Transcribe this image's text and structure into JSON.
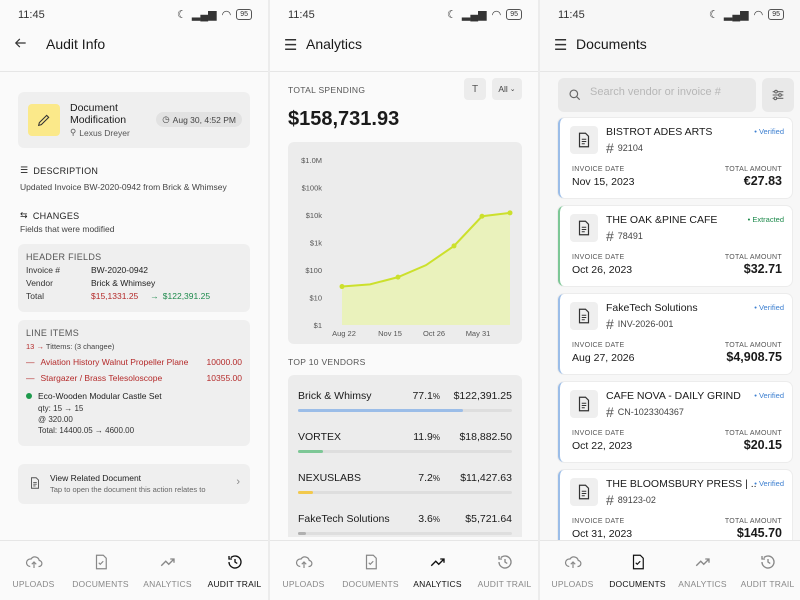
{
  "status": {
    "time": "11:45",
    "battery": "95"
  },
  "nav": {
    "uploads": "UPLOADS",
    "documents": "DOCUMENTS",
    "analytics": "ANALYTICS",
    "audit_trail": "AUDIT TRAIL"
  },
  "audit": {
    "title": "Audit Info",
    "doc_title": "Document Modification",
    "user": "Lexus Dreyer",
    "date": "Aug 30, 4:52 PM",
    "description_head": "DESCRIPTION",
    "description_text": "Updated Invoice BW-2020-0942 from Brick & Whimsey",
    "changes_head": "CHANGES",
    "changes_text": "Fields that were modified",
    "header_fields": {
      "label": "HEADER FIELDS",
      "rows": [
        {
          "k": "Invoice #",
          "v": "BW-2020-0942"
        },
        {
          "k": "Vendor",
          "v": "Brick & Whimsey"
        }
      ],
      "total_label": "Total",
      "total_old": "$15,1331.25",
      "total_new": "$122,391.25"
    },
    "line_items": {
      "label": "LINE ITEMS",
      "sub_count": "13",
      "sub_text": "Tittems: (3 changee)",
      "removed": [
        {
          "name": "Aviation History Walnut Propeller Plane",
          "value": "10000.00"
        },
        {
          "name": "Stargazer / Brass Telesoloscope",
          "value": "10355.00"
        }
      ],
      "changed_name": "Eco-Wooden Modular Castle Set",
      "changed_qty": "qty: 15 → 15",
      "changed_price": "@ 320.00",
      "changed_total": "Total: 14400.05 → 4600.00"
    },
    "related": {
      "title": "View Related Document",
      "sub": "Tap to open the document this action relates to"
    }
  },
  "analytics": {
    "title": "Analytics",
    "total_label": "TOTAL SPENDING",
    "t_button": "T",
    "filter": "All",
    "total": "$158,731.93",
    "vendors_label": "TOP 10 VENDORS",
    "vendors": [
      {
        "name": "Brick & Whimsy",
        "pct": "77.1",
        "amount": "$122,391.25",
        "share": 0.771,
        "color": "#9bbde8"
      },
      {
        "name": "VORTEX",
        "pct": "11.9",
        "amount": "$18,882.50",
        "share": 0.119,
        "color": "#7dc796"
      },
      {
        "name": "NEXUSLABS",
        "pct": "7.2",
        "amount": "$11,427.63",
        "share": 0.072,
        "color": "#f2c94c"
      },
      {
        "name": "FakeTech Solutions",
        "pct": "3.6",
        "amount": "$5,721.64",
        "share": 0.036,
        "color": "#b0b0b0"
      }
    ]
  },
  "chart_data": {
    "type": "area",
    "x": [
      "Aug 22",
      "Sep 4",
      "Nov 15",
      "Oct 15",
      "Oct 26",
      "May 31",
      "Jun 5"
    ],
    "x_tick_labels": [
      "Aug 22",
      "Nov 15",
      "Oct 26",
      "May 31"
    ],
    "y_tick_labels": [
      "$1.0M",
      "$100k",
      "$10k",
      "$1k",
      "$100",
      "$10",
      "$1"
    ],
    "y_scale": "log",
    "ylim": [
      1,
      1000000
    ],
    "values": [
      25,
      30,
      55,
      150,
      750,
      9000,
      12000
    ],
    "color": "#cce02c"
  },
  "documents": {
    "title": "Documents",
    "search_placeholder": "Search vendor or invoice #",
    "date_label": "INVOICE DATE",
    "amount_label": "TOTAL AMOUNT",
    "items": [
      {
        "vendor": "BISTROT ADES ARTS",
        "number": "92104",
        "status": "Verified",
        "date": "Nov 15, 2023",
        "amount": "€27.83"
      },
      {
        "vendor": "THE OAK &PINE CAFE",
        "number": "78491",
        "status": "Extracted",
        "date": "Oct 26, 2023",
        "amount": "$32.71"
      },
      {
        "vendor": "FakeTech Solutions",
        "number": "INV-2026-001",
        "status": "Verified",
        "date": "Aug 27, 2026",
        "amount": "$4,908.75"
      },
      {
        "vendor": "CAFE NOVA - DAILY GRIND",
        "number": "CN-1023304367",
        "status": "Verified",
        "date": "Oct 22, 2023",
        "amount": "$20.15"
      },
      {
        "vendor": "THE BLOOMSBURY PRESS | ...",
        "number": "89123-02",
        "status": "Verified",
        "date": "Oct 31, 2023",
        "amount": "$145.70"
      }
    ]
  }
}
